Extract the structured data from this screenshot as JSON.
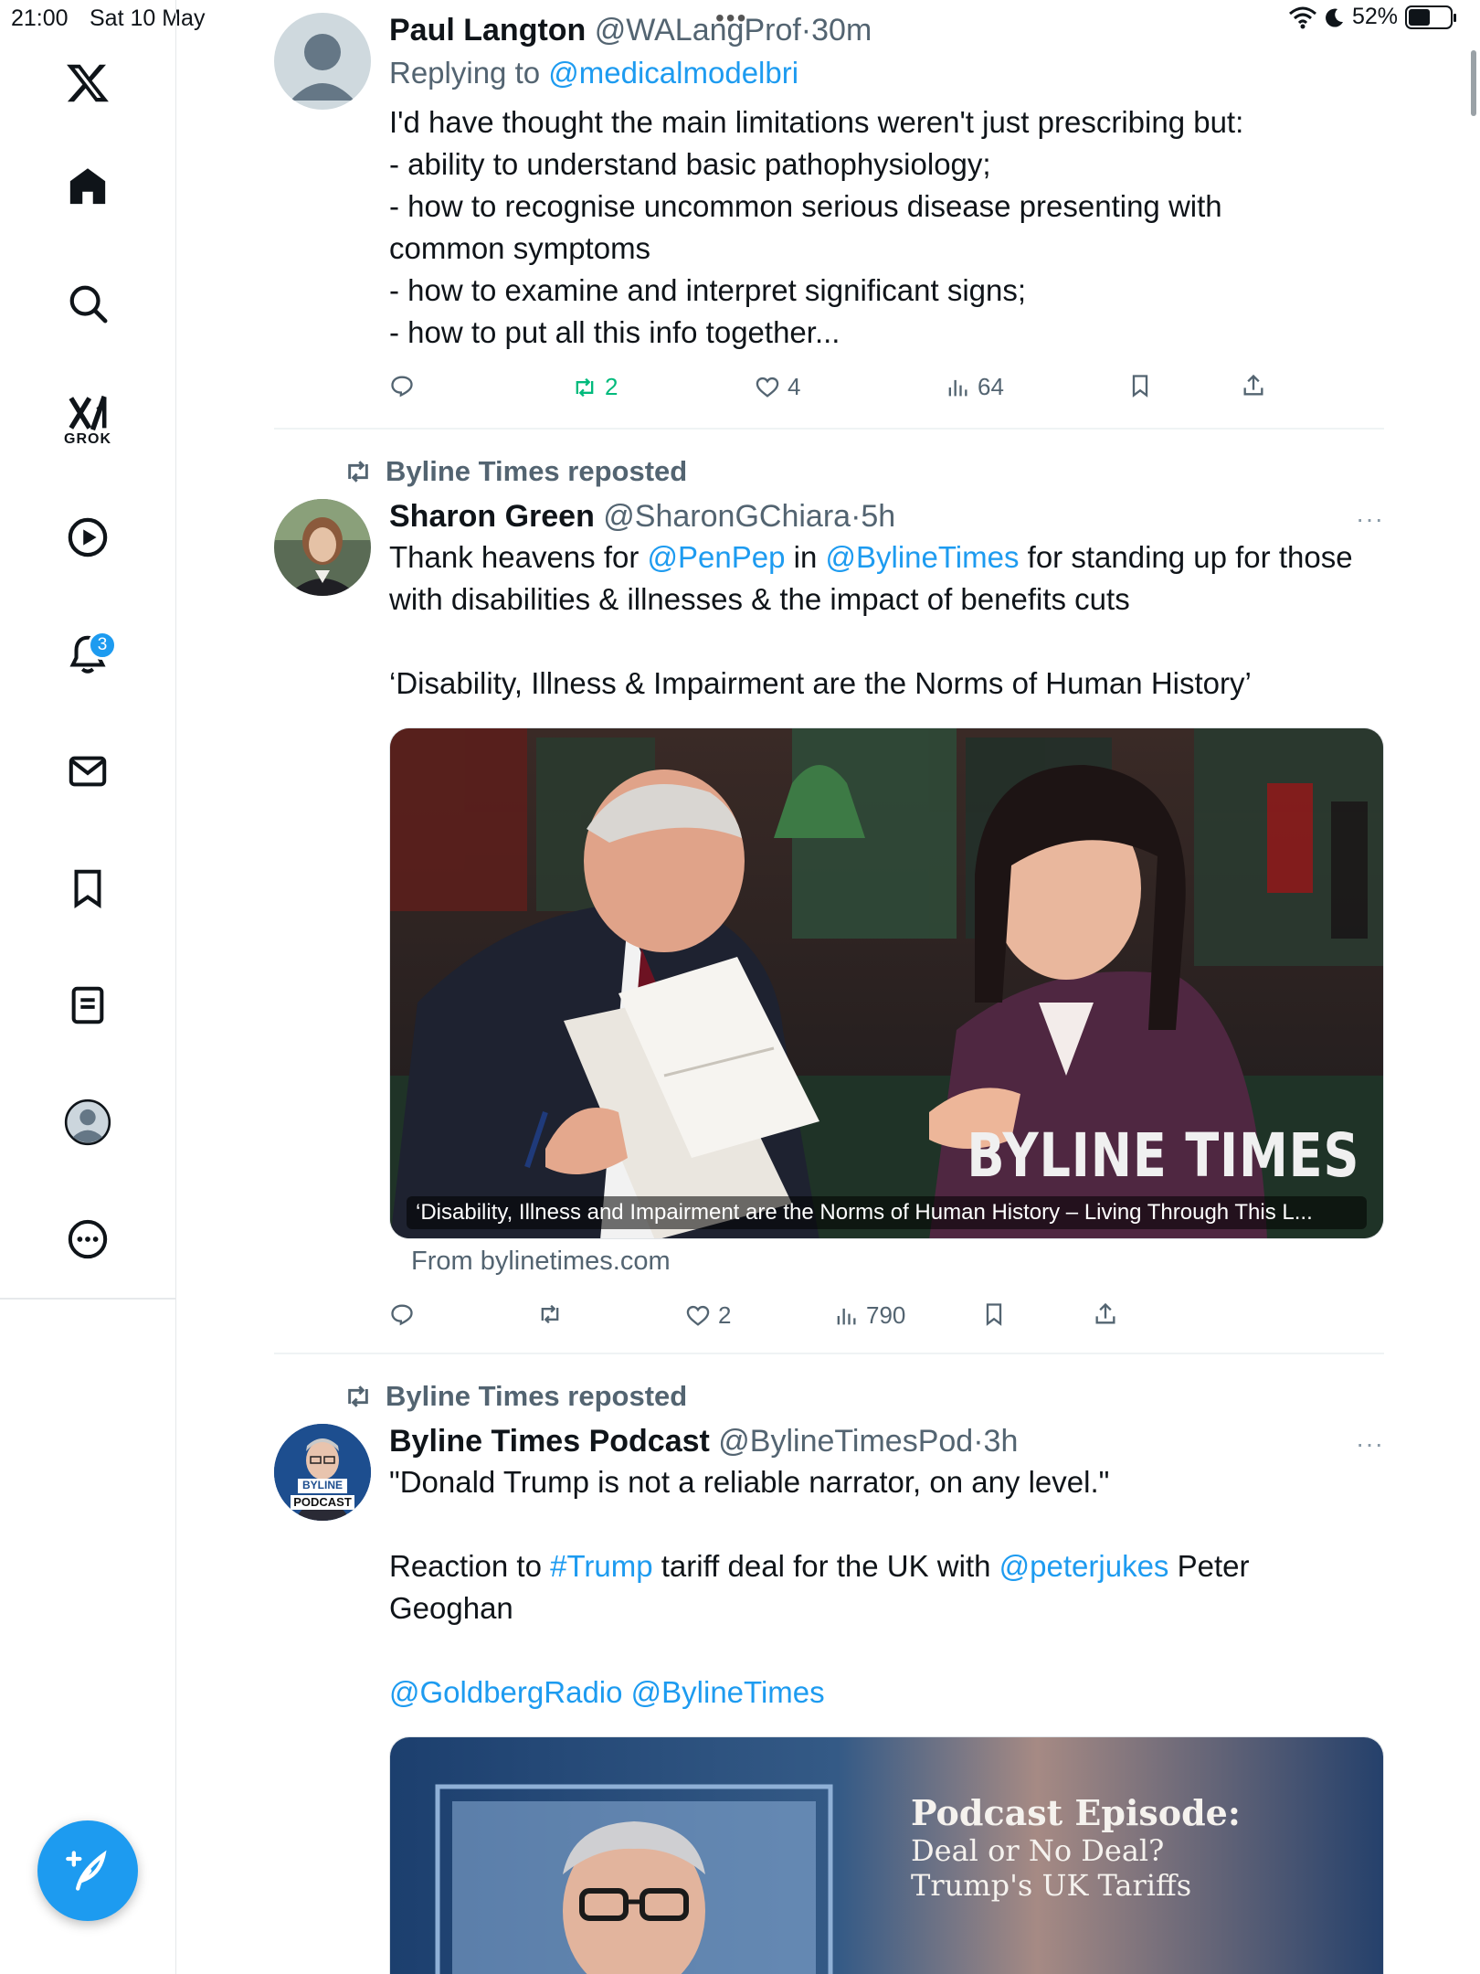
{
  "status_bar": {
    "time": "21:00",
    "date": "Sat 10 May",
    "battery": "52%",
    "battery_level": 0.52
  },
  "sidebar": {
    "grok_label": "GROK",
    "notifications_count": "3",
    "icons": [
      "x-logo-icon",
      "home-icon",
      "search-icon",
      "grok-icon",
      "video-icon",
      "bell-icon",
      "mail-icon",
      "bookmark-icon",
      "lists-icon",
      "profile-icon",
      "more-circle-icon"
    ]
  },
  "posts": [
    {
      "name": "Paul Langton",
      "handle": "@WALangProf",
      "sep": "·",
      "time": "30m",
      "replying_prefix": "Replying to",
      "replying_to": "@medicalmodelbri",
      "lines": [
        "I'd have thought the main limitations weren't just prescribing but:",
        "- ability to understand basic pathophysiology;",
        "- how to recognise uncommon serious disease presenting with",
        "common symptoms",
        "- how to examine and interpret significant signs;",
        "- how to put all this info together..."
      ],
      "reposts": "2",
      "likes": "4",
      "views": "64"
    },
    {
      "reposted_by": "Byline Times reposted",
      "name": "Sharon Green",
      "handle": "@SharonGChiara",
      "sep": "·",
      "time": "5h",
      "more": "···",
      "text_1": "Thank heavens for",
      "mention_1": "@PenPep",
      "text_2": "in",
      "mention_2": "@BylineTimes",
      "text_3": "for standing up for those",
      "line_2": "with disabilities & illnesses & the impact of benefits cuts",
      "quote": "‘Disability, Illness & Impairment are the Norms of Human History’",
      "card_caption": "‘Disability, Illness and Impairment are the Norms of Human History – Living Through This L...",
      "card_watermark": "BYLINE TIMES",
      "card_from": "From bylinetimes.com",
      "likes": "2",
      "views": "790"
    },
    {
      "reposted_by": "Byline Times reposted",
      "name": "Byline Times Podcast",
      "handle": "@BylineTimesPod",
      "sep": "·",
      "time": "3h",
      "more": "···",
      "avatar_label_1": "BYLINE",
      "avatar_label_2": "PODCAST",
      "line_1": "\"Donald Trump is not a reliable narrator, on any level.\"",
      "text_a": "Reaction to",
      "hashtag": "#Trump",
      "text_b": "tariff deal for the UK with",
      "mention": "@peterjukes",
      "text_c": "Peter",
      "line_3": "Geoghan",
      "mentions_line": "@GoldbergRadio @BylineTimes",
      "card_title": "Podcast Episode:",
      "card_sub_1": "Deal or No Deal?",
      "card_sub_2": "Trump's UK Tariffs"
    }
  ],
  "colors": {
    "accent": "#1d9bf0",
    "text": "#0f1419",
    "muted": "#536471",
    "repost_green": "#00ba7c"
  }
}
